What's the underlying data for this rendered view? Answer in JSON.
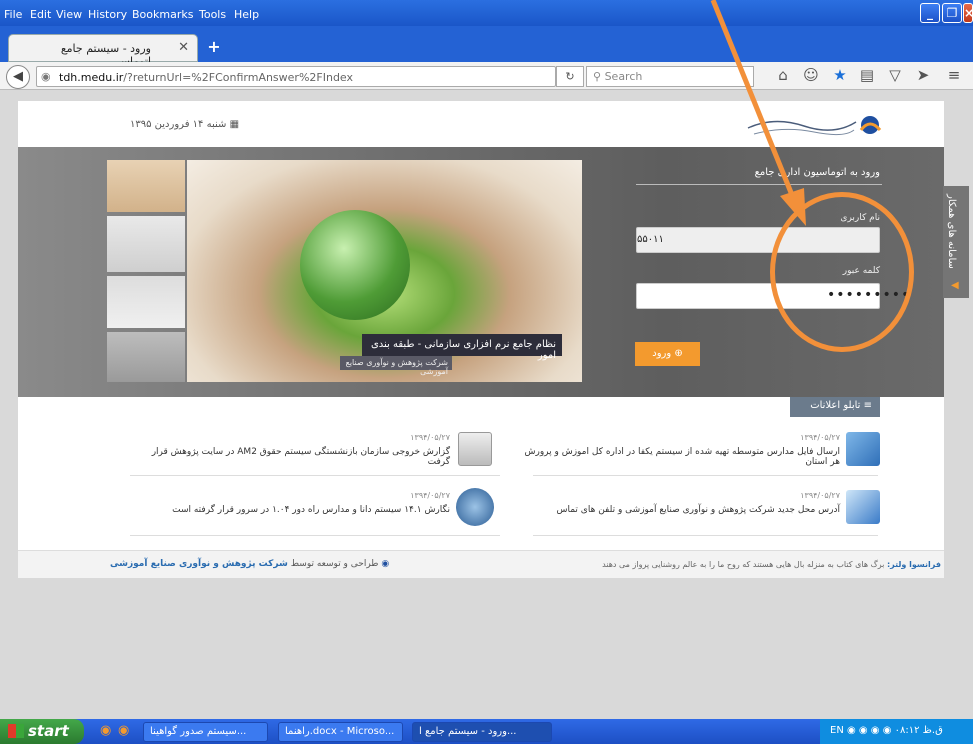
{
  "browser": {
    "menu": [
      "File",
      "Edit",
      "View",
      "History",
      "Bookmarks",
      "Tools",
      "Help"
    ],
    "tab_title": "ورود - سیستم جامع اتوماسی...",
    "url_host": "tdh.medu.ir",
    "url_path": "/?returnUrl=%2FConfirmAnswer%2FIndex",
    "search_placeholder": "Search"
  },
  "site": {
    "date_text": "شنبه ۱۴ فروردین ۱۳۹۵",
    "slide_caption": "نظام جامع نرم افزاری سازمانی - طبقه بندی امور",
    "slide_subcaption": "شرکت پژوهش و نوآوری صنایع آموزشی",
    "login": {
      "title": "ورود به اتوماسیون اداری جامع",
      "username_label": "نام کاربری",
      "username_value": "۵۵۰۱۱",
      "password_label": "کلمه عبور",
      "password_value": "•••••••••",
      "submit_label": "ورود"
    },
    "side_tab_label": "سامانه های همکار",
    "news_button": "تابلو اعلانات",
    "news": [
      {
        "date": "۱۳۹۴/۰۵/۲۷",
        "text": "ارسال فایل مدارس متوسطه تهیه شده از سیستم یکفا در اداره کل اموزش و پرورش هر استان"
      },
      {
        "date": "۱۳۹۴/۰۵/۲۷",
        "text": "گزارش خروجی سازمان بازنشستگی سیستم حقوق AM2 در سایت پژوهش قرار گرفت"
      },
      {
        "date": "۱۳۹۴/۰۵/۲۷",
        "text": "آدرس محل جدید شرکت پژوهش و نوآوری صنایع آموزشی و تلفن های تماس"
      },
      {
        "date": "۱۳۹۴/۰۵/۲۷",
        "text": "نگارش ۱۴.۱ سیستم دانا و مدارس راه دور ۱.۰۴ در سرور قرار گرفته است"
      }
    ],
    "footer_left_prefix": "طراحی و توسعه توسط",
    "footer_left_company": "شرکت پژوهش و نوآوری صنایع آموزشی",
    "footer_quote_author": "فرانسوا ولتر:",
    "footer_quote": "برگ های کتاب به منزله بال هایی هستند که روح ما را به عالم روشنایی پرواز می دهند"
  },
  "taskbar": {
    "start_label": "start",
    "tasks": [
      "سیستم صدور گواهینا...",
      "راهنما.docx - Microso...",
      "ورود - سیستم جامع ا..."
    ],
    "tray_lang": "EN",
    "tray_time": "۰۸:۱۲ ق.ظ"
  },
  "colors": {
    "accent_orange": "#f2903a",
    "login_button": "#f39a2e",
    "titlebar_blue": "#2462d4"
  }
}
